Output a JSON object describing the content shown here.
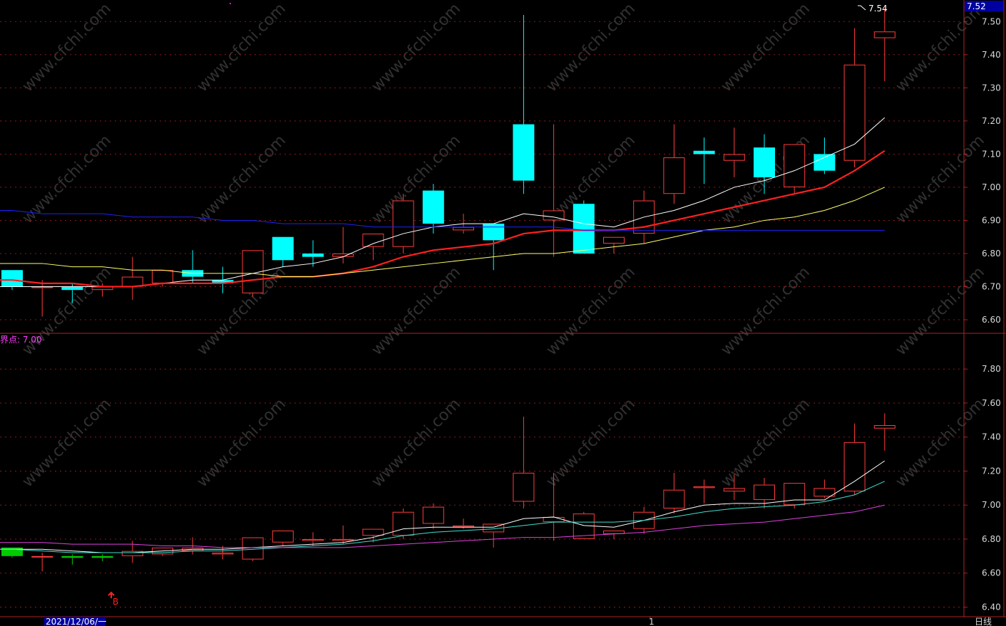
{
  "panels": {
    "upper": {
      "current_price_label": "7.52",
      "high_label": "7.54",
      "y_ticks": [
        "7.50",
        "7.40",
        "7.30",
        "7.20",
        "7.10",
        "7.00",
        "6.90",
        "6.80",
        "6.70",
        "6.60"
      ]
    },
    "lower": {
      "indicator_label": "界点: 7.00",
      "signal_label": "B",
      "y_ticks": [
        "7.80",
        "7.60",
        "7.40",
        "7.20",
        "7.00",
        "6.80",
        "6.60",
        "6.40"
      ]
    }
  },
  "footer": {
    "date_label": "2021/12/06/一",
    "period_label": "日线",
    "marker_label": "1"
  },
  "watermark": "www.cfchi.com",
  "colors": {
    "up": "#ff3b3b",
    "down_upper": "#00ffff",
    "down_lower": "#00cc00",
    "ma_white": "#ffffff",
    "ma_red": "#ff2020",
    "ma_yellow": "#ffff66",
    "ma_blue": "#2020ff",
    "ma_cyan": "#40e0d0",
    "ma_magenta": "#e040e0",
    "grid": "#8b1a1a",
    "axis": "#b22222"
  },
  "chart_data": {
    "type": "candlestick",
    "candles": [
      {
        "o": 6.75,
        "h": 6.75,
        "l": 6.69,
        "c": 6.7
      },
      {
        "o": 6.7,
        "h": 6.72,
        "l": 6.61,
        "c": 6.7
      },
      {
        "o": 6.7,
        "h": 6.71,
        "l": 6.65,
        "c": 6.69
      },
      {
        "o": 6.69,
        "h": 6.71,
        "l": 6.67,
        "c": 6.7
      },
      {
        "o": 6.7,
        "h": 6.79,
        "l": 6.66,
        "c": 6.73
      },
      {
        "o": 6.71,
        "h": 6.75,
        "l": 6.7,
        "c": 6.75
      },
      {
        "o": 6.75,
        "h": 6.81,
        "l": 6.71,
        "c": 6.73
      },
      {
        "o": 6.72,
        "h": 6.76,
        "l": 6.68,
        "c": 6.71
      },
      {
        "o": 6.68,
        "h": 6.81,
        "l": 6.67,
        "c": 6.81
      },
      {
        "o": 6.85,
        "h": 6.85,
        "l": 6.76,
        "c": 6.78
      },
      {
        "o": 6.8,
        "h": 6.84,
        "l": 6.76,
        "c": 6.79
      },
      {
        "o": 6.79,
        "h": 6.88,
        "l": 6.77,
        "c": 6.8
      },
      {
        "o": 6.82,
        "h": 6.86,
        "l": 6.78,
        "c": 6.86
      },
      {
        "o": 6.82,
        "h": 6.98,
        "l": 6.8,
        "c": 6.96
      },
      {
        "o": 6.99,
        "h": 7.01,
        "l": 6.86,
        "c": 6.89
      },
      {
        "o": 6.87,
        "h": 6.92,
        "l": 6.86,
        "c": 6.88
      },
      {
        "o": 6.89,
        "h": 6.89,
        "l": 6.75,
        "c": 6.84
      },
      {
        "o": 7.19,
        "h": 7.52,
        "l": 6.98,
        "c": 7.02
      },
      {
        "o": 6.9,
        "h": 7.19,
        "l": 6.79,
        "c": 6.93
      },
      {
        "o": 6.95,
        "h": 6.96,
        "l": 6.8,
        "c": 6.8
      },
      {
        "o": 6.83,
        "h": 6.85,
        "l": 6.8,
        "c": 6.85
      },
      {
        "o": 6.86,
        "h": 6.99,
        "l": 6.83,
        "c": 6.96
      },
      {
        "o": 6.98,
        "h": 7.19,
        "l": 6.95,
        "c": 7.09
      },
      {
        "o": 7.11,
        "h": 7.15,
        "l": 7.01,
        "c": 7.1
      },
      {
        "o": 7.08,
        "h": 7.18,
        "l": 7.03,
        "c": 7.1
      },
      {
        "o": 7.12,
        "h": 7.16,
        "l": 6.98,
        "c": 7.03
      },
      {
        "o": 7.0,
        "h": 7.13,
        "l": 6.98,
        "c": 7.13
      },
      {
        "o": 7.1,
        "h": 7.15,
        "l": 7.04,
        "c": 7.05
      },
      {
        "o": 7.08,
        "h": 7.48,
        "l": 7.06,
        "c": 7.37
      },
      {
        "o": 7.45,
        "h": 7.54,
        "l": 7.32,
        "c": 7.47
      }
    ],
    "upper_ylim": [
      6.57,
      7.55
    ],
    "lower_ylim": [
      6.36,
      7.96
    ],
    "lower_down_candles": [
      0,
      2,
      3
    ],
    "ma_upper": {
      "white": [
        6.7,
        6.7,
        6.7,
        6.7,
        6.7,
        6.71,
        6.72,
        6.72,
        6.74,
        6.76,
        6.77,
        6.79,
        6.83,
        6.86,
        6.88,
        6.89,
        6.89,
        6.92,
        6.91,
        6.89,
        6.88,
        6.91,
        6.93,
        6.96,
        7.0,
        7.02,
        7.05,
        7.09,
        7.13,
        7.21
      ],
      "red": [
        6.72,
        6.71,
        6.71,
        6.7,
        6.7,
        6.71,
        6.71,
        6.71,
        6.72,
        6.73,
        6.73,
        6.74,
        6.76,
        6.79,
        6.81,
        6.82,
        6.83,
        6.86,
        6.87,
        6.87,
        6.87,
        6.88,
        6.9,
        6.92,
        6.94,
        6.96,
        6.98,
        7.0,
        7.05,
        7.11
      ],
      "yellow": [
        6.77,
        6.77,
        6.76,
        6.76,
        6.75,
        6.75,
        6.74,
        6.74,
        6.74,
        6.73,
        6.73,
        6.74,
        6.75,
        6.76,
        6.77,
        6.78,
        6.79,
        6.8,
        6.8,
        6.81,
        6.82,
        6.83,
        6.85,
        6.87,
        6.88,
        6.9,
        6.91,
        6.93,
        6.96,
        7.0
      ],
      "blue": [
        6.93,
        6.92,
        6.92,
        6.92,
        6.91,
        6.91,
        6.91,
        6.9,
        6.9,
        6.89,
        6.89,
        6.89,
        6.88,
        6.88,
        6.88,
        6.88,
        6.88,
        6.88,
        6.88,
        6.87,
        6.87,
        6.87,
        6.87,
        6.87,
        6.87,
        6.87,
        6.87,
        6.87,
        6.87,
        6.87
      ]
    },
    "ma_lower": {
      "white": [
        6.74,
        6.74,
        6.73,
        6.72,
        6.72,
        6.73,
        6.74,
        6.74,
        6.75,
        6.76,
        6.77,
        6.78,
        6.81,
        6.86,
        6.87,
        6.87,
        6.87,
        6.92,
        6.93,
        6.88,
        6.87,
        6.91,
        6.96,
        7.0,
        7.01,
        7.01,
        7.03,
        7.03,
        7.14,
        7.26
      ],
      "cyan": [
        6.74,
        6.73,
        6.72,
        6.72,
        6.72,
        6.72,
        6.73,
        6.73,
        6.74,
        6.75,
        6.76,
        6.77,
        6.79,
        6.82,
        6.84,
        6.85,
        6.86,
        6.88,
        6.9,
        6.9,
        6.9,
        6.91,
        6.93,
        6.96,
        6.98,
        6.99,
        7.0,
        7.02,
        7.06,
        7.14
      ],
      "magenta": [
        6.78,
        6.78,
        6.77,
        6.77,
        6.77,
        6.76,
        6.76,
        6.75,
        6.75,
        6.75,
        6.75,
        6.75,
        6.76,
        6.77,
        6.78,
        6.79,
        6.8,
        6.81,
        6.81,
        6.82,
        6.83,
        6.84,
        6.86,
        6.88,
        6.89,
        6.9,
        6.92,
        6.94,
        6.96,
        7.0
      ]
    }
  }
}
